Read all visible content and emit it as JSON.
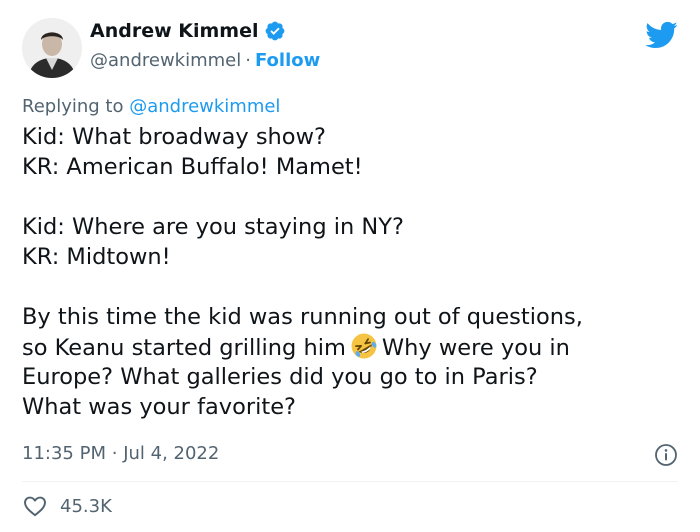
{
  "author": {
    "name": "Andrew Kimmel",
    "handle": "@andrewkimmel",
    "separator": "·",
    "follow_label": "Follow"
  },
  "reply": {
    "prefix": "Replying to ",
    "mention": "@andrewkimmel"
  },
  "tweet": {
    "p1_line1": "Kid: What broadway show?",
    "p1_line2": "KR: American Buffalo! Mamet!",
    "p2_line1": "Kid: Where are you staying in NY?",
    "p2_line2": "KR: Midtown!",
    "p3_line1": "By this time the kid was running out of questions,",
    "p3_line2a": "so Keanu started grilling him",
    "p3_line2b": "Why were you in",
    "p3_line3": "Europe? What galleries did you go to in Paris?",
    "p3_line4": "What was your favorite?",
    "emoji": "rolling-on-floor-laughing"
  },
  "meta": {
    "time": "11:35 PM",
    "separator": "·",
    "date": "Jul 4, 2022"
  },
  "stats": {
    "likes": "45.3K"
  },
  "colors": {
    "accent": "#1d9bf0",
    "text": "#0f1419",
    "muted": "#536471",
    "divider": "#eff3f4"
  }
}
